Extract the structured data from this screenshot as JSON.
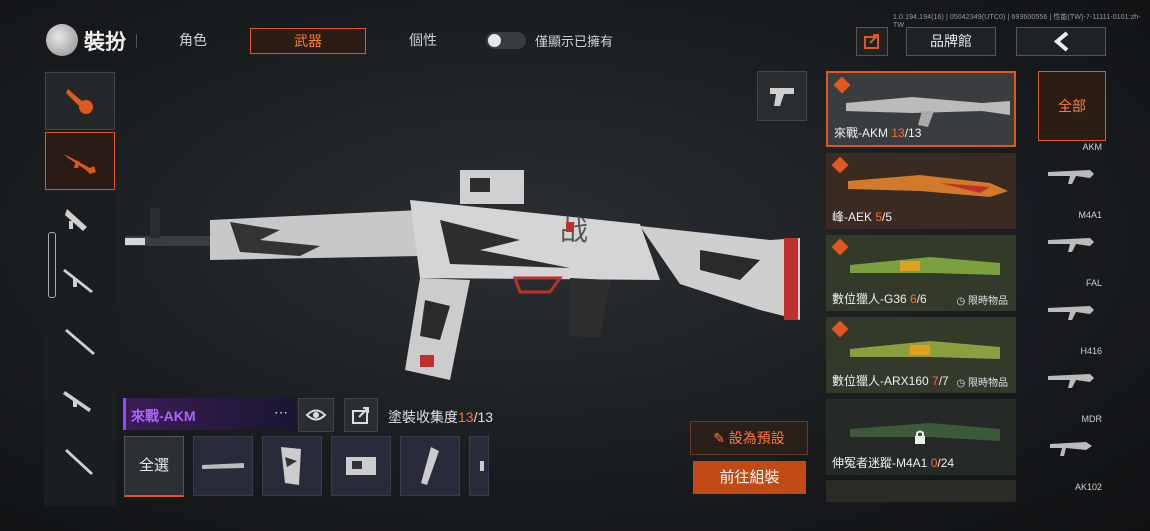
{
  "header": {
    "title": "裝扮",
    "tabs": [
      {
        "label": "角色"
      },
      {
        "label": "武器"
      },
      {
        "label": "個性"
      }
    ],
    "toggle_label": "僅顯示已擁有",
    "build_info": "1.0.194.194(16) | 05042349(UTC0) | 693600556 | 性能(TW)-7-11111-0101:zh-TW",
    "brand_button": "品牌館"
  },
  "left_categories": [
    {
      "icon": "spray-paint-icon"
    },
    {
      "icon": "assault-rifle-icon"
    },
    {
      "icon": "smg-icon"
    },
    {
      "icon": "shotgun-icon"
    },
    {
      "icon": "sniper-rifle-icon"
    },
    {
      "icon": "marksman-rifle-icon"
    },
    {
      "icon": "lmg-icon"
    }
  ],
  "weapon": {
    "name": "來戰-AKM",
    "collect_label": "塗裝收集度",
    "collect_have": "13",
    "collect_total": "/13"
  },
  "bottom_bar": {
    "all_label": "全選",
    "slots": [
      "weapon-slot-icon",
      "stock-attachment-icon",
      "optic-attachment-icon",
      "muzzle-attachment-icon",
      "magazine-attachment-icon"
    ]
  },
  "actions": {
    "set_preset": "設為預設",
    "go_assemble": "前往組裝"
  },
  "skins": [
    {
      "name": "來戰-AKM ",
      "count": "13",
      "total": "/13",
      "limited": ""
    },
    {
      "name": "峰-AEK ",
      "count": "5",
      "total": "/5",
      "limited": ""
    },
    {
      "name": "數位獵人-G36 ",
      "count": "6",
      "total": "/6",
      "limited": "限時物品"
    },
    {
      "name": "數位獵人-ARX160 ",
      "count": "7",
      "total": "/7",
      "limited": "限時物品"
    },
    {
      "name": "伸冤者迷蹤-M4A1 ",
      "count": "0",
      "total": "/24",
      "limited": ""
    }
  ],
  "right_filter": {
    "all_label": "全部",
    "weapons": [
      "AKM",
      "M4A1",
      "FAL",
      "H416",
      "MDR",
      "AK102"
    ]
  },
  "colors": {
    "accent": "#e0571f",
    "purple": "#a044ff"
  }
}
